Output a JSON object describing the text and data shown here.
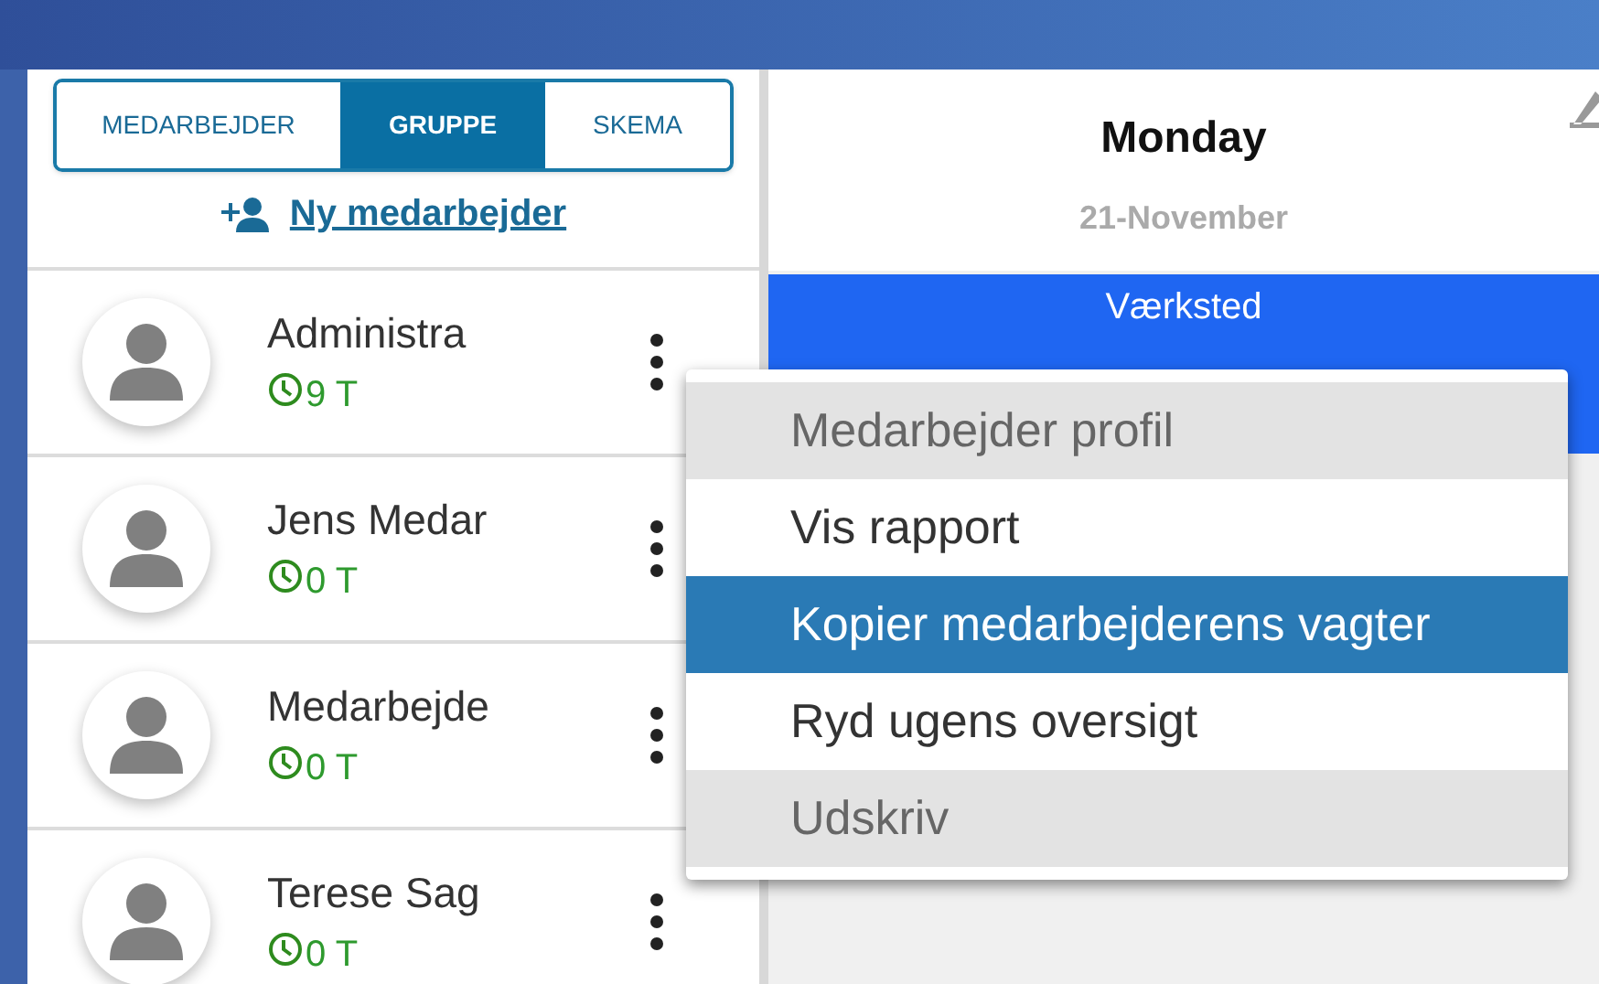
{
  "tabs": [
    {
      "label": "MEDARBEJDER",
      "selected": false
    },
    {
      "label": "GRUPPE",
      "selected": true
    },
    {
      "label": "SKEMA",
      "selected": false
    }
  ],
  "new_employee_link": "Ny medarbejder",
  "employees": [
    {
      "name": "Administra",
      "hours": "9 T"
    },
    {
      "name": "Jens Medar",
      "hours": "0 T"
    },
    {
      "name": "Medarbejde",
      "hours": "0 T"
    },
    {
      "name": "Terese Sag",
      "hours": "0 T"
    }
  ],
  "day": {
    "name": "Monday",
    "date": "21-November"
  },
  "shift": {
    "title": "Værksted"
  },
  "context_menu": [
    {
      "label": "Medarbejder profil",
      "disabled": true,
      "selected": false
    },
    {
      "label": "Vis rapport",
      "disabled": false,
      "selected": false
    },
    {
      "label": "Kopier medarbejderens vagter",
      "disabled": false,
      "selected": true
    },
    {
      "label": "Ryd ugens oversigt",
      "disabled": false,
      "selected": false
    },
    {
      "label": "Udskriv",
      "disabled": true,
      "selected": false
    }
  ]
}
